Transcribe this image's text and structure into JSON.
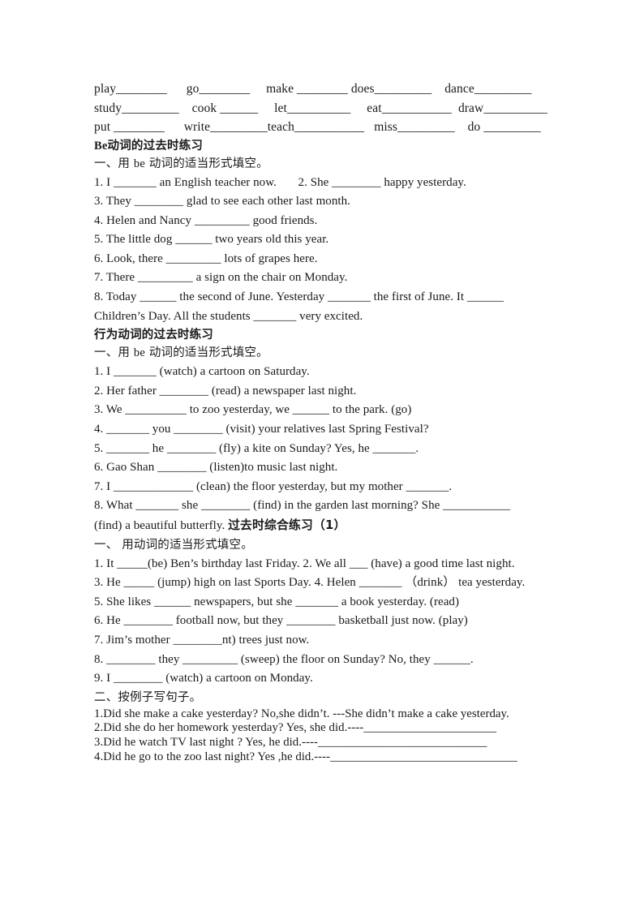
{
  "document": {
    "verb_list": {
      "rows": [
        "play________      go________     make ________ does_________    dance_________",
        "study_________    cook ______     let__________     eat___________  draw__________",
        "put ________      write_________teach___________   miss_________    do _________"
      ]
    },
    "section_be": {
      "heading_cn": "Be",
      "heading_cn_rest": "动词的过去时练习",
      "instruction": "一、用 be 动词的适当形式填空。",
      "instruction_prefix": "一、用 ",
      "instruction_en": "be",
      "instruction_suffix": " 动词的适当形式填空。",
      "questions": [
        "1. I _______ an English teacher now.       2. She ________ happy yesterday.",
        "3. They ________ glad to see each other last month.",
        "4. Helen and Nancy _________ good friends.",
        "5. The little dog ______ two years old this year.",
        "6. Look, there _________ lots of grapes here.",
        "7. There _________ a sign on the chair on Monday.",
        "8. Today ______ the second of June. Yesterday _______ the first of June. It ______",
        "Children’s Day. All the students _______ very excited."
      ]
    },
    "section_action": {
      "heading": "行为动词的过去时练习",
      "instruction_prefix": "一、用 ",
      "instruction_en": "be",
      "instruction_suffix": " 动词的适当形式填空。",
      "questions": [
        "1. I _______ (watch) a cartoon on Saturday.",
        "2. Her father ________ (read) a newspaper last night.",
        "3. We __________ to zoo yesterday, we ______ to the park. (go)",
        "4. _______ you ________ (visit) your relatives last Spring Festival?",
        "5. _______ he ________ (fly) a kite on Sunday? Yes, he _______.",
        "6. Gao Shan ________ (listen)to music last night.",
        "7. I _____________ (clean) the floor yesterday, but my mother _______.",
        "8. What _______ she ________ (find) in the garden last morning? She ___________"
      ],
      "last_line_text": "(find) a beautiful butterfly. ",
      "last_line_heading": "过去时综合练习（1）"
    },
    "section_review": {
      "instruction": "一、 用动词的适当形式填空。",
      "questions": [
        "1. It _____(be) Ben’s birthday last Friday. 2. We all ___ (have) a good time last night.",
        "3. He _____ (jump) high on last Sports Day. 4. Helen _______ （drink） tea yesterday.",
        "5. She likes ______ newspapers, but she _______ a book yesterday. (read)",
        "6. He ________ football now, but they ________ basketball just now. (play)",
        "7. Jim’s mother ________nt) trees just now.",
        "8. ________ they _________ (sweep) the floor on Sunday? No, they ______.",
        "9. I ________ (watch) a cartoon on Monday."
      ]
    },
    "section_sentences": {
      "instruction": "二、按例子写句子。",
      "questions": [
        "1.Did she make a cake yesterday? No,she didn’t. ---She didn’t make a cake yesterday.",
        "2.Did she do her homework yesterday? Yes, she did.----______________________",
        "3.Did he watch TV last night ? Yes, he did.----____________________________",
        "4.Did he go to the zoo last night? Yes ,he did.----_______________________________"
      ]
    }
  }
}
